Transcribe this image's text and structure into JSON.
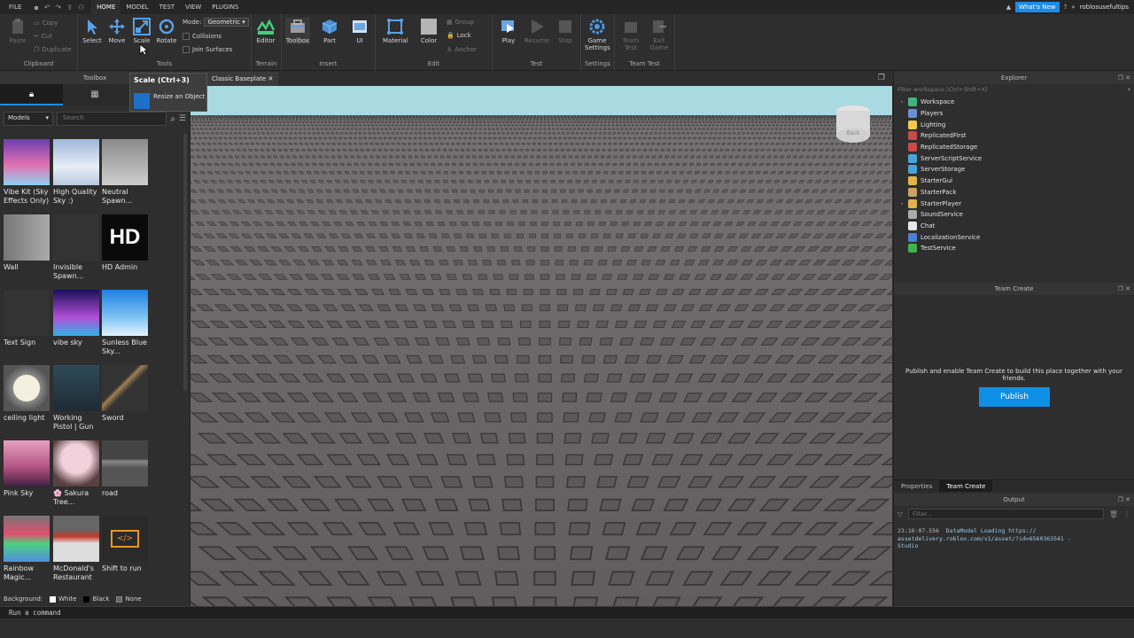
{
  "titlebar": {
    "menu": [
      "FILE",
      "HOME",
      "MODEL",
      "TEST",
      "VIEW",
      "PLUGINS"
    ],
    "active_menu": "HOME",
    "whats_new": "What's New",
    "username": "roblosusefultips"
  },
  "ribbon": {
    "clipboard": {
      "label": "Clipboard",
      "paste": "Paste",
      "copy": "Copy",
      "cut": "Cut",
      "duplicate": "Duplicate"
    },
    "tools": {
      "label": "Tools",
      "select": "Select",
      "move": "Move",
      "scale": "Scale",
      "rotate": "Rotate",
      "mode_label": "Mode:",
      "mode_value": "Geometric",
      "collisions": "Collisions",
      "join_surfaces": "Join Surfaces"
    },
    "terrain": {
      "label": "Terrain",
      "editor": "Editor"
    },
    "insert": {
      "label": "Insert",
      "toolbox": "Toolbox",
      "part": "Part",
      "ui": "UI"
    },
    "edit": {
      "label": "Edit",
      "material": "Material",
      "color": "Color",
      "group": "Group",
      "lock": "Lock",
      "anchor": "Anchor"
    },
    "test": {
      "label": "Test",
      "play": "Play",
      "resume": "Resume",
      "stop": "Stop"
    },
    "settings": {
      "label": "Settings",
      "game_settings_1": "Game",
      "game_settings_2": "Settings"
    },
    "team_test": {
      "label": "Team Test",
      "team_1": "Team",
      "team_2": "Test",
      "exit_1": "Exit",
      "exit_2": "Game"
    }
  },
  "tooltip": {
    "title": "Scale (Ctrl+3)",
    "description": "Resize an Object"
  },
  "toolbox": {
    "title": "Toolbox",
    "category": "Models",
    "search_placeholder": "Search",
    "items": [
      {
        "label": "Vibe Kit (Sky Effects Only)"
      },
      {
        "label": "High Quality Sky :)"
      },
      {
        "label": "Neutral Spawn..."
      },
      {
        "label": "Wall"
      },
      {
        "label": "Invisible Spawn..."
      },
      {
        "label": "HD Admin"
      },
      {
        "label": "Text Sign"
      },
      {
        "label": "vibe sky"
      },
      {
        "label": "Sunless Blue Sky..."
      },
      {
        "label": "ceiling light"
      },
      {
        "label": "Working Pistol | Gun"
      },
      {
        "label": "Sword"
      },
      {
        "label": "Pink Sky"
      },
      {
        "label": "🌸 Sakura Tree..."
      },
      {
        "label": "road"
      },
      {
        "label": "Rainbow Magic..."
      },
      {
        "label": "McDonald's Restaurant"
      },
      {
        "label": "Shift to run"
      }
    ],
    "hd_text": "HD",
    "background_label": "Background:",
    "bg_white": "White",
    "bg_black": "Black",
    "bg_none": "None"
  },
  "viewport": {
    "tab_label": "Classic Baseplate",
    "view_cube_label": "Back"
  },
  "explorer": {
    "title": "Explorer",
    "filter_placeholder": "Filter workspace (Ctrl+Shift+X)",
    "items": [
      {
        "label": "Workspace",
        "expandable": true,
        "color": "#3fb37f"
      },
      {
        "label": "Players",
        "expandable": false,
        "color": "#6b8fd6"
      },
      {
        "label": "Lighting",
        "expandable": false,
        "color": "#f2c94c"
      },
      {
        "label": "ReplicatedFirst",
        "expandable": false,
        "color": "#c94a4a"
      },
      {
        "label": "ReplicatedStorage",
        "expandable": false,
        "color": "#c94a4a"
      },
      {
        "label": "ServerScriptService",
        "expandable": false,
        "color": "#4aa3d6"
      },
      {
        "label": "ServerStorage",
        "expandable": false,
        "color": "#4aa3d6"
      },
      {
        "label": "StarterGui",
        "expandable": false,
        "color": "#e0b64c"
      },
      {
        "label": "StarterPack",
        "expandable": false,
        "color": "#c9a266"
      },
      {
        "label": "StarterPlayer",
        "expandable": true,
        "color": "#e0b64c"
      },
      {
        "label": "SoundService",
        "expandable": false,
        "color": "#aaaaaa"
      },
      {
        "label": "Chat",
        "expandable": false,
        "color": "#e6e6e6"
      },
      {
        "label": "LocalizationService",
        "expandable": false,
        "color": "#4a7fd6"
      },
      {
        "label": "TestService",
        "expandable": false,
        "color": "#3fb34f"
      }
    ]
  },
  "team_create": {
    "title": "Team Create",
    "message": "Publish and enable Team Create to build this place together with your friends.",
    "publish": "Publish",
    "tab_properties": "Properties",
    "tab_team_create": "Team Create"
  },
  "output": {
    "title": "Output",
    "filter_placeholder": "Filter...",
    "lines": [
      {
        "time": "23:16:07.556",
        "text": "DataModel Loading https://"
      },
      {
        "time": "",
        "text": "assetdelivery.roblox.com/v1/asset/?id=6560363541  -"
      },
      {
        "time": "",
        "text": "Studio"
      }
    ]
  },
  "command_bar": {
    "placeholder": "Run a command"
  },
  "colors": {
    "accent": "#1e8be6",
    "sky": "#a8d8e0",
    "baseplate": "#6a6868"
  }
}
